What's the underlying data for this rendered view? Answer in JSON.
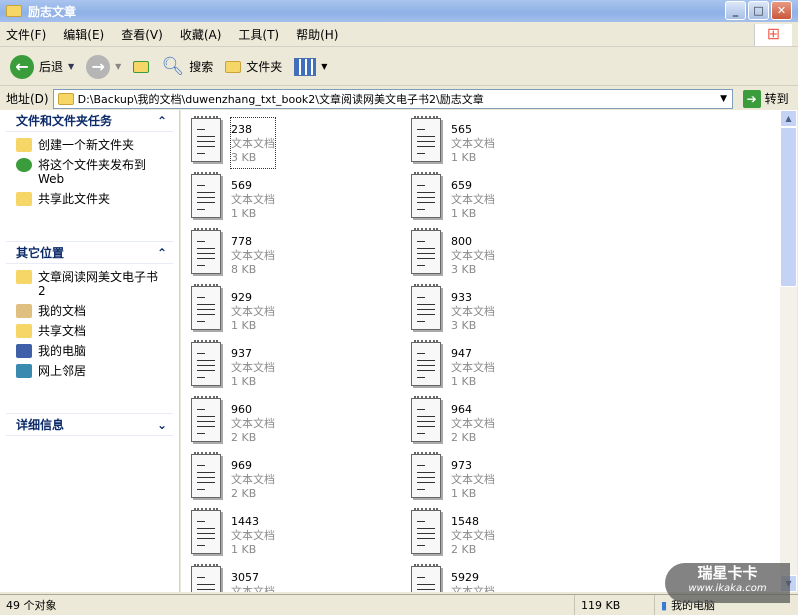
{
  "window": {
    "title": "励志文章"
  },
  "menu": [
    "文件(F)",
    "编辑(E)",
    "查看(V)",
    "收藏(A)",
    "工具(T)",
    "帮助(H)"
  ],
  "toolbar": {
    "back": "后退",
    "search": "搜索",
    "folders": "文件夹"
  },
  "address": {
    "label": "地址(D)",
    "path": "D:\\Backup\\我的文档\\duwenzhang_txt_book2\\文章阅读网美文电子书2\\励志文章",
    "go": "转到"
  },
  "tasks": {
    "title": "文件和文件夹任务",
    "items": [
      "创建一个新文件夹",
      "将这个文件夹发布到 Web",
      "共享此文件夹"
    ]
  },
  "places": {
    "title": "其它位置",
    "items": [
      "文章阅读网美文电子书2",
      "我的文档",
      "共享文档",
      "我的电脑",
      "网上邻居"
    ]
  },
  "details": {
    "title": "详细信息"
  },
  "files": [
    {
      "name": "238",
      "type": "文本文档",
      "size": "3 KB"
    },
    {
      "name": "565",
      "type": "文本文档",
      "size": "1 KB"
    },
    {
      "name": "569",
      "type": "文本文档",
      "size": "1 KB"
    },
    {
      "name": "659",
      "type": "文本文档",
      "size": "1 KB"
    },
    {
      "name": "778",
      "type": "文本文档",
      "size": "8 KB"
    },
    {
      "name": "800",
      "type": "文本文档",
      "size": "3 KB"
    },
    {
      "name": "929",
      "type": "文本文档",
      "size": "1 KB"
    },
    {
      "name": "933",
      "type": "文本文档",
      "size": "3 KB"
    },
    {
      "name": "937",
      "type": "文本文档",
      "size": "1 KB"
    },
    {
      "name": "947",
      "type": "文本文档",
      "size": "1 KB"
    },
    {
      "name": "960",
      "type": "文本文档",
      "size": "2 KB"
    },
    {
      "name": "964",
      "type": "文本文档",
      "size": "2 KB"
    },
    {
      "name": "969",
      "type": "文本文档",
      "size": "2 KB"
    },
    {
      "name": "973",
      "type": "文本文档",
      "size": "1 KB"
    },
    {
      "name": "1443",
      "type": "文本文档",
      "size": "1 KB"
    },
    {
      "name": "1548",
      "type": "文本文档",
      "size": "2 KB"
    },
    {
      "name": "3057",
      "type": "文本文档"
    },
    {
      "name": "5929",
      "type": "文本文档"
    }
  ],
  "status": {
    "count": "49 个对象",
    "size": "119 KB",
    "location": "我的电脑"
  },
  "watermark": {
    "brand": "瑞星卡卡",
    "url": "www.ikaka.com"
  }
}
